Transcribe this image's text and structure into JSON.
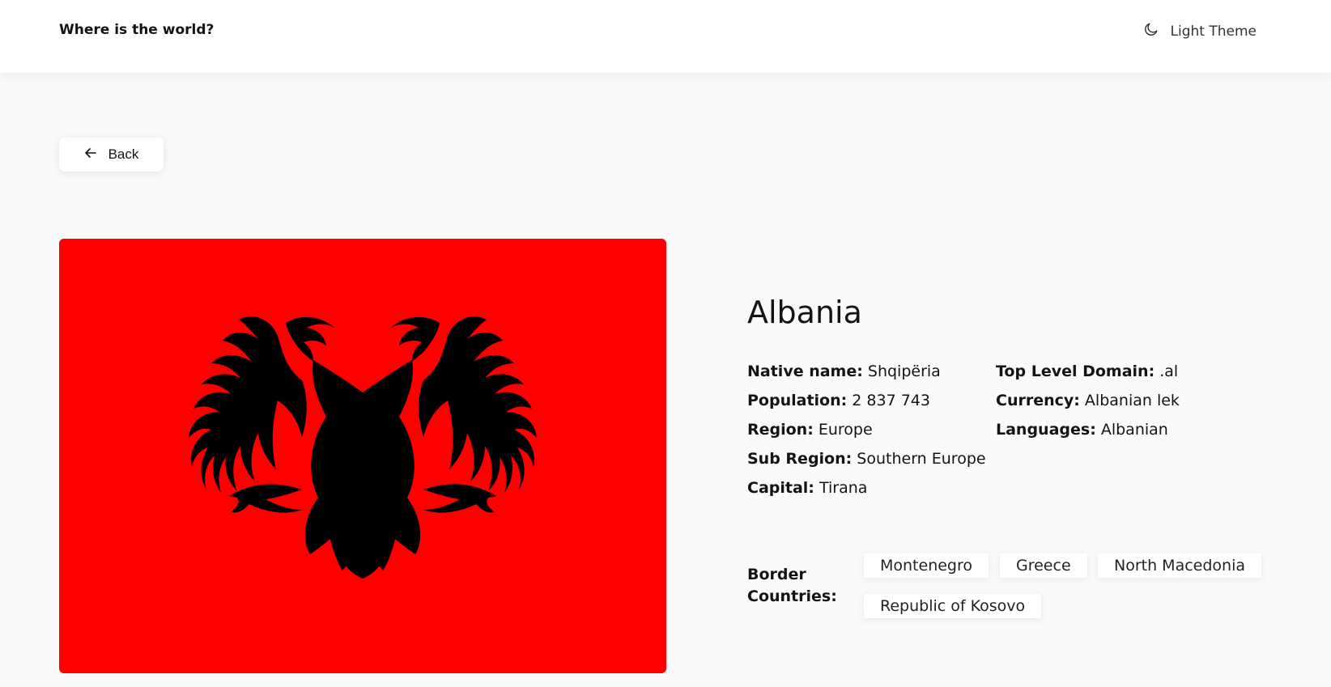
{
  "header": {
    "brand": "Where is the world?",
    "theme_label": "Light Theme",
    "theme_icon": "moon-icon"
  },
  "back_button": {
    "label": "Back",
    "icon": "arrow-left-icon"
  },
  "flag": {
    "alt": "Flag of Albania",
    "background": "#ff0000",
    "emblem_color": "#000000"
  },
  "country": {
    "name": "Albania",
    "details_left": [
      {
        "label": "Native name:",
        "value": "Shqipëria"
      },
      {
        "label": "Population:",
        "value": "2 837 743"
      },
      {
        "label": "Region:",
        "value": "Europe"
      },
      {
        "label": "Sub Region:",
        "value": "Southern Europe"
      },
      {
        "label": "Capital:",
        "value": "Tirana"
      }
    ],
    "details_right": [
      {
        "label": "Top Level Domain:",
        "value": ".al"
      },
      {
        "label": "Currency:",
        "value": "Albanian lek"
      },
      {
        "label": "Languages:",
        "value": "Albanian"
      }
    ],
    "border_label": "Border Countries:",
    "borders": [
      "Montenegro",
      "Greece",
      "North Macedonia",
      "Republic of Kosovo"
    ]
  }
}
